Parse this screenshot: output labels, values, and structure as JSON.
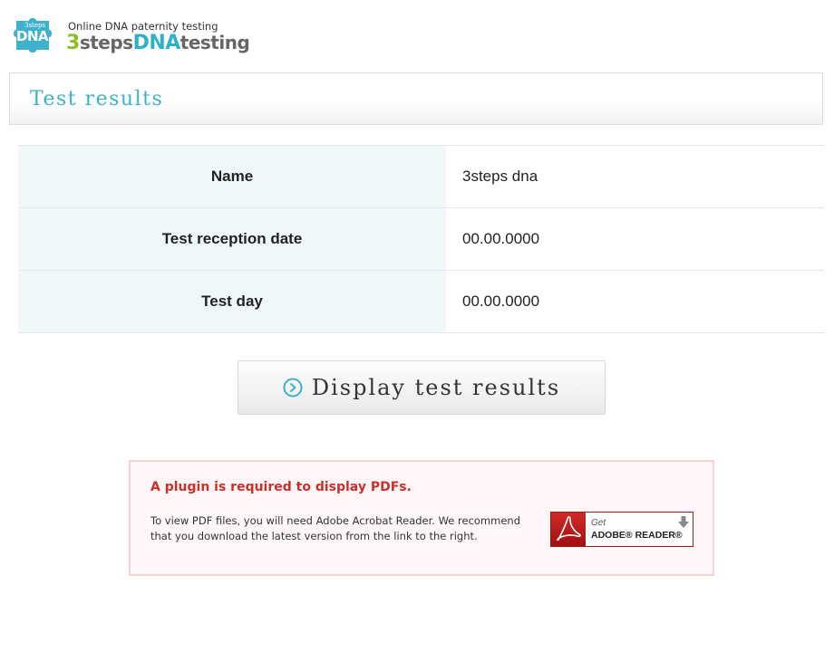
{
  "header": {
    "logo": {
      "badge_text": "DNA",
      "badge_small_text": "3steps",
      "tagline": "Online DNA paternity testing",
      "wordmark": {
        "part1": "3",
        "part2": "steps",
        "part3": "DNA",
        "part4": "testing"
      }
    }
  },
  "page": {
    "title": "Test results"
  },
  "info_table": {
    "rows": [
      {
        "label": "Name",
        "value": "3steps dna"
      },
      {
        "label": "Test reception date",
        "value": "00.00.0000"
      },
      {
        "label": "Test day",
        "value": "00.00.0000"
      }
    ]
  },
  "display_button": {
    "icon": "circle-chevron-right-icon",
    "label": "Display test results"
  },
  "plugin_notice": {
    "title": "A plugin is required to display PDFs.",
    "body": "To view PDF files, you will need Adobe Acrobat Reader. We recommend that you download the latest version from the link to the right.",
    "reader_badge": {
      "get_text": "Get",
      "name_text": "ADOBE® READER®",
      "icon": "acrobat-icon",
      "arrow_icon": "download-arrow-icon"
    }
  },
  "colors": {
    "accent_teal": "#3cb3c4",
    "logo_green": "#8cbe2a",
    "logo_blue": "#2fb0c9",
    "notice_red": "#c9302c",
    "notice_border": "#f6d3d5",
    "table_label_bg": "#f0f7f9"
  }
}
